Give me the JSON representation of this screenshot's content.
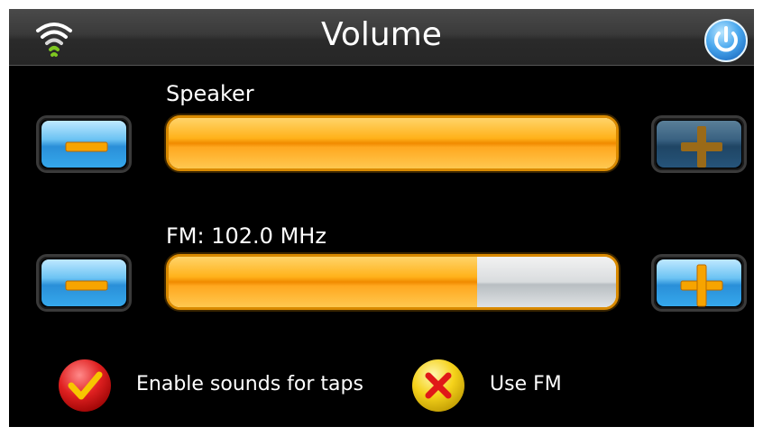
{
  "header": {
    "title": "Volume",
    "wifi_icon": "wifi-icon",
    "power_icon": "power-icon"
  },
  "speaker": {
    "label": "Speaker",
    "level": 1.0,
    "minus_icon": "minus-icon",
    "plus_icon": "plus-icon"
  },
  "fm": {
    "label": "FM: 102.0 MHz",
    "level": 0.69,
    "minus_icon": "minus-icon",
    "plus_icon": "plus-icon"
  },
  "options": {
    "tap_sounds": {
      "label": "Enable sounds for taps",
      "checked": true,
      "icon": "checkmark-icon"
    },
    "use_fm": {
      "label": "Use FM",
      "checked": false,
      "icon": "cross-icon"
    }
  },
  "colors": {
    "accent_orange": "#f5a300",
    "button_blue": "#2a8fd8",
    "check_red": "#d81818",
    "cross_yellow": "#f5d21a"
  }
}
